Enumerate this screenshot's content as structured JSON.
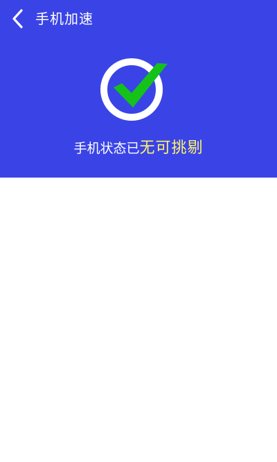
{
  "topbar": {
    "back_icon": "chevron-left-icon",
    "title": "手机加速"
  },
  "status": {
    "icon": "checkmark-circle-icon",
    "message_prefix": "手机状态已",
    "message_highlight": "无可挑剔"
  },
  "colors": {
    "header_background": "#3a44e6",
    "check_green": "#14c21a",
    "highlight_yellow": "#fff567",
    "text_white": "#ffffff"
  }
}
